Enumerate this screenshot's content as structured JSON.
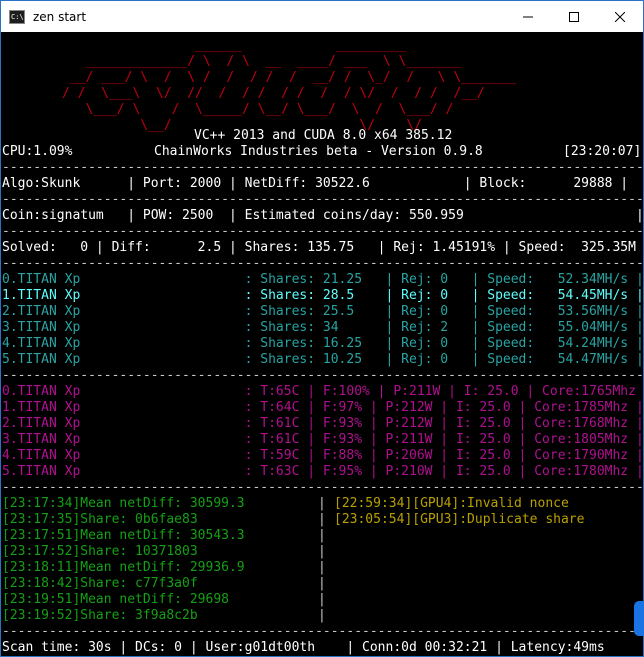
{
  "window": {
    "title": "zen start",
    "icon_text": "C:\\."
  },
  "banner": [
    "                 ______            _________",
    "   _____________/ \\  / \\  __  ____/ ___  \\ \\_______",
    " __/ ___/ \\  /  \\ /  /  / /  /  __/ /  \\_/  /   \\ \\_______",
    "/ /  \\___\\  \\/  //  /  / /  / /  /  / \\/  /  / /  /__/",
    "   \\___/ \\    /  \\_____/ \\__/ \\___/  \\  /  \\___/ /",
    "          \\__/                        \\/    \\/"
  ],
  "header": {
    "build": "VC++ 2013 and CUDA 8.0 x64 385.12",
    "cpu": "CPU:1.09%",
    "company": "ChainWorks Industries beta - Version 0.9.8",
    "time": "[23:20:07]"
  },
  "rows": {
    "sep1": "-----------------------------------------------------------------------------------",
    "algo_line": "Algo:Skunk      | Port: 2000 | NetDiff: 30522.6            | Block:      29888 |",
    "sep2": "-----------------------------------------------------------------------------------",
    "coin_line": "Coin:signatum   | POW: 2500  | Estimated coins/day: 550.959                      |",
    "sep3": "-----------------------------------------------------------------------------------",
    "solved_line": "Solved:   0 | Diff:      2.5 | Shares: 135.75   | Rej: 1.45191% | Speed:  325.35M",
    "sep4": "-----------------------------------------------------------------------------------",
    "sep5": "-----------------------------------------------------------------------------------",
    "sep6": "-----------------------------------------------------------------------------------",
    "sep7": "-----------------------------------------------------------------------------------"
  },
  "gpu_shares": [
    "0.TITAN Xp                     : Shares: 21.25   | Rej: 0   | Speed:   52.34MH/s |",
    "1.TITAN Xp                     : Shares: 28.5    | Rej: 0   | Speed:   54.45MH/s |",
    "2.TITAN Xp                     : Shares: 25.5    | Rej: 0   | Speed:   53.56MH/s |",
    "3.TITAN Xp                     : Shares: 34      | Rej: 2   | Speed:   55.04MH/s |",
    "4.TITAN Xp                     : Shares: 16.25   | Rej: 0   | Speed:   54.24MH/s |",
    "5.TITAN Xp                     : Shares: 10.25   | Rej: 0   | Speed:   54.47MH/s |"
  ],
  "gpu_stats": [
    "0.TITAN Xp                     : T:65C | F:100% | P:211W | I: 25.0 | Core:1765Mhz |",
    "1.TITAN Xp                     : T:64C | F:97% | P:212W | I: 25.0 | Core:1785Mhz |",
    "2.TITAN Xp                     : T:61C | F:93% | P:212W | I: 25.0 | Core:1768Mhz |",
    "3.TITAN Xp                     : T:61C | F:93% | P:211W | I: 25.0 | Core:1805Mhz |",
    "4.TITAN Xp                     : T:59C | F:88% | P:206W | I: 25.0 | Core:1790Mhz |",
    "5.TITAN Xp                     : T:63C | F:95% | P:210W | I: 25.0 | Core:1780Mhz |"
  ],
  "log_left": [
    "[23:17:34]Mean netDiff: 30599.3",
    "[23:17:35]Share: 0b6fae83",
    "[23:17:51]Mean netDiff: 30543.3",
    "[23:17:52]Share: 10371803",
    "[23:18:11]Mean netDiff: 29936.9",
    "[23:18:42]Share: c77f3a0f",
    "[23:19:51]Mean netDiff: 29698",
    "[23:19:52]Share: 3f9a8c2b"
  ],
  "log_divider": "|",
  "log_right": [
    "[22:59:34][GPU4]:Invalid nonce",
    "[23:05:54][GPU3]:Duplicate share"
  ],
  "status": {
    "line": "Scan time: 30s | DCs: 0 | User:g01dt00th    | Conn:0d 00:32:21 | Latency:49ms"
  },
  "colors": {
    "banner": "#c0000f",
    "text": "#c8c8c8",
    "gpu": "#29a3a3",
    "gpu_highlight": "#5fffff",
    "gpu_stats": "#b0108f",
    "log": "#14a014",
    "warn": "#b8a000"
  }
}
